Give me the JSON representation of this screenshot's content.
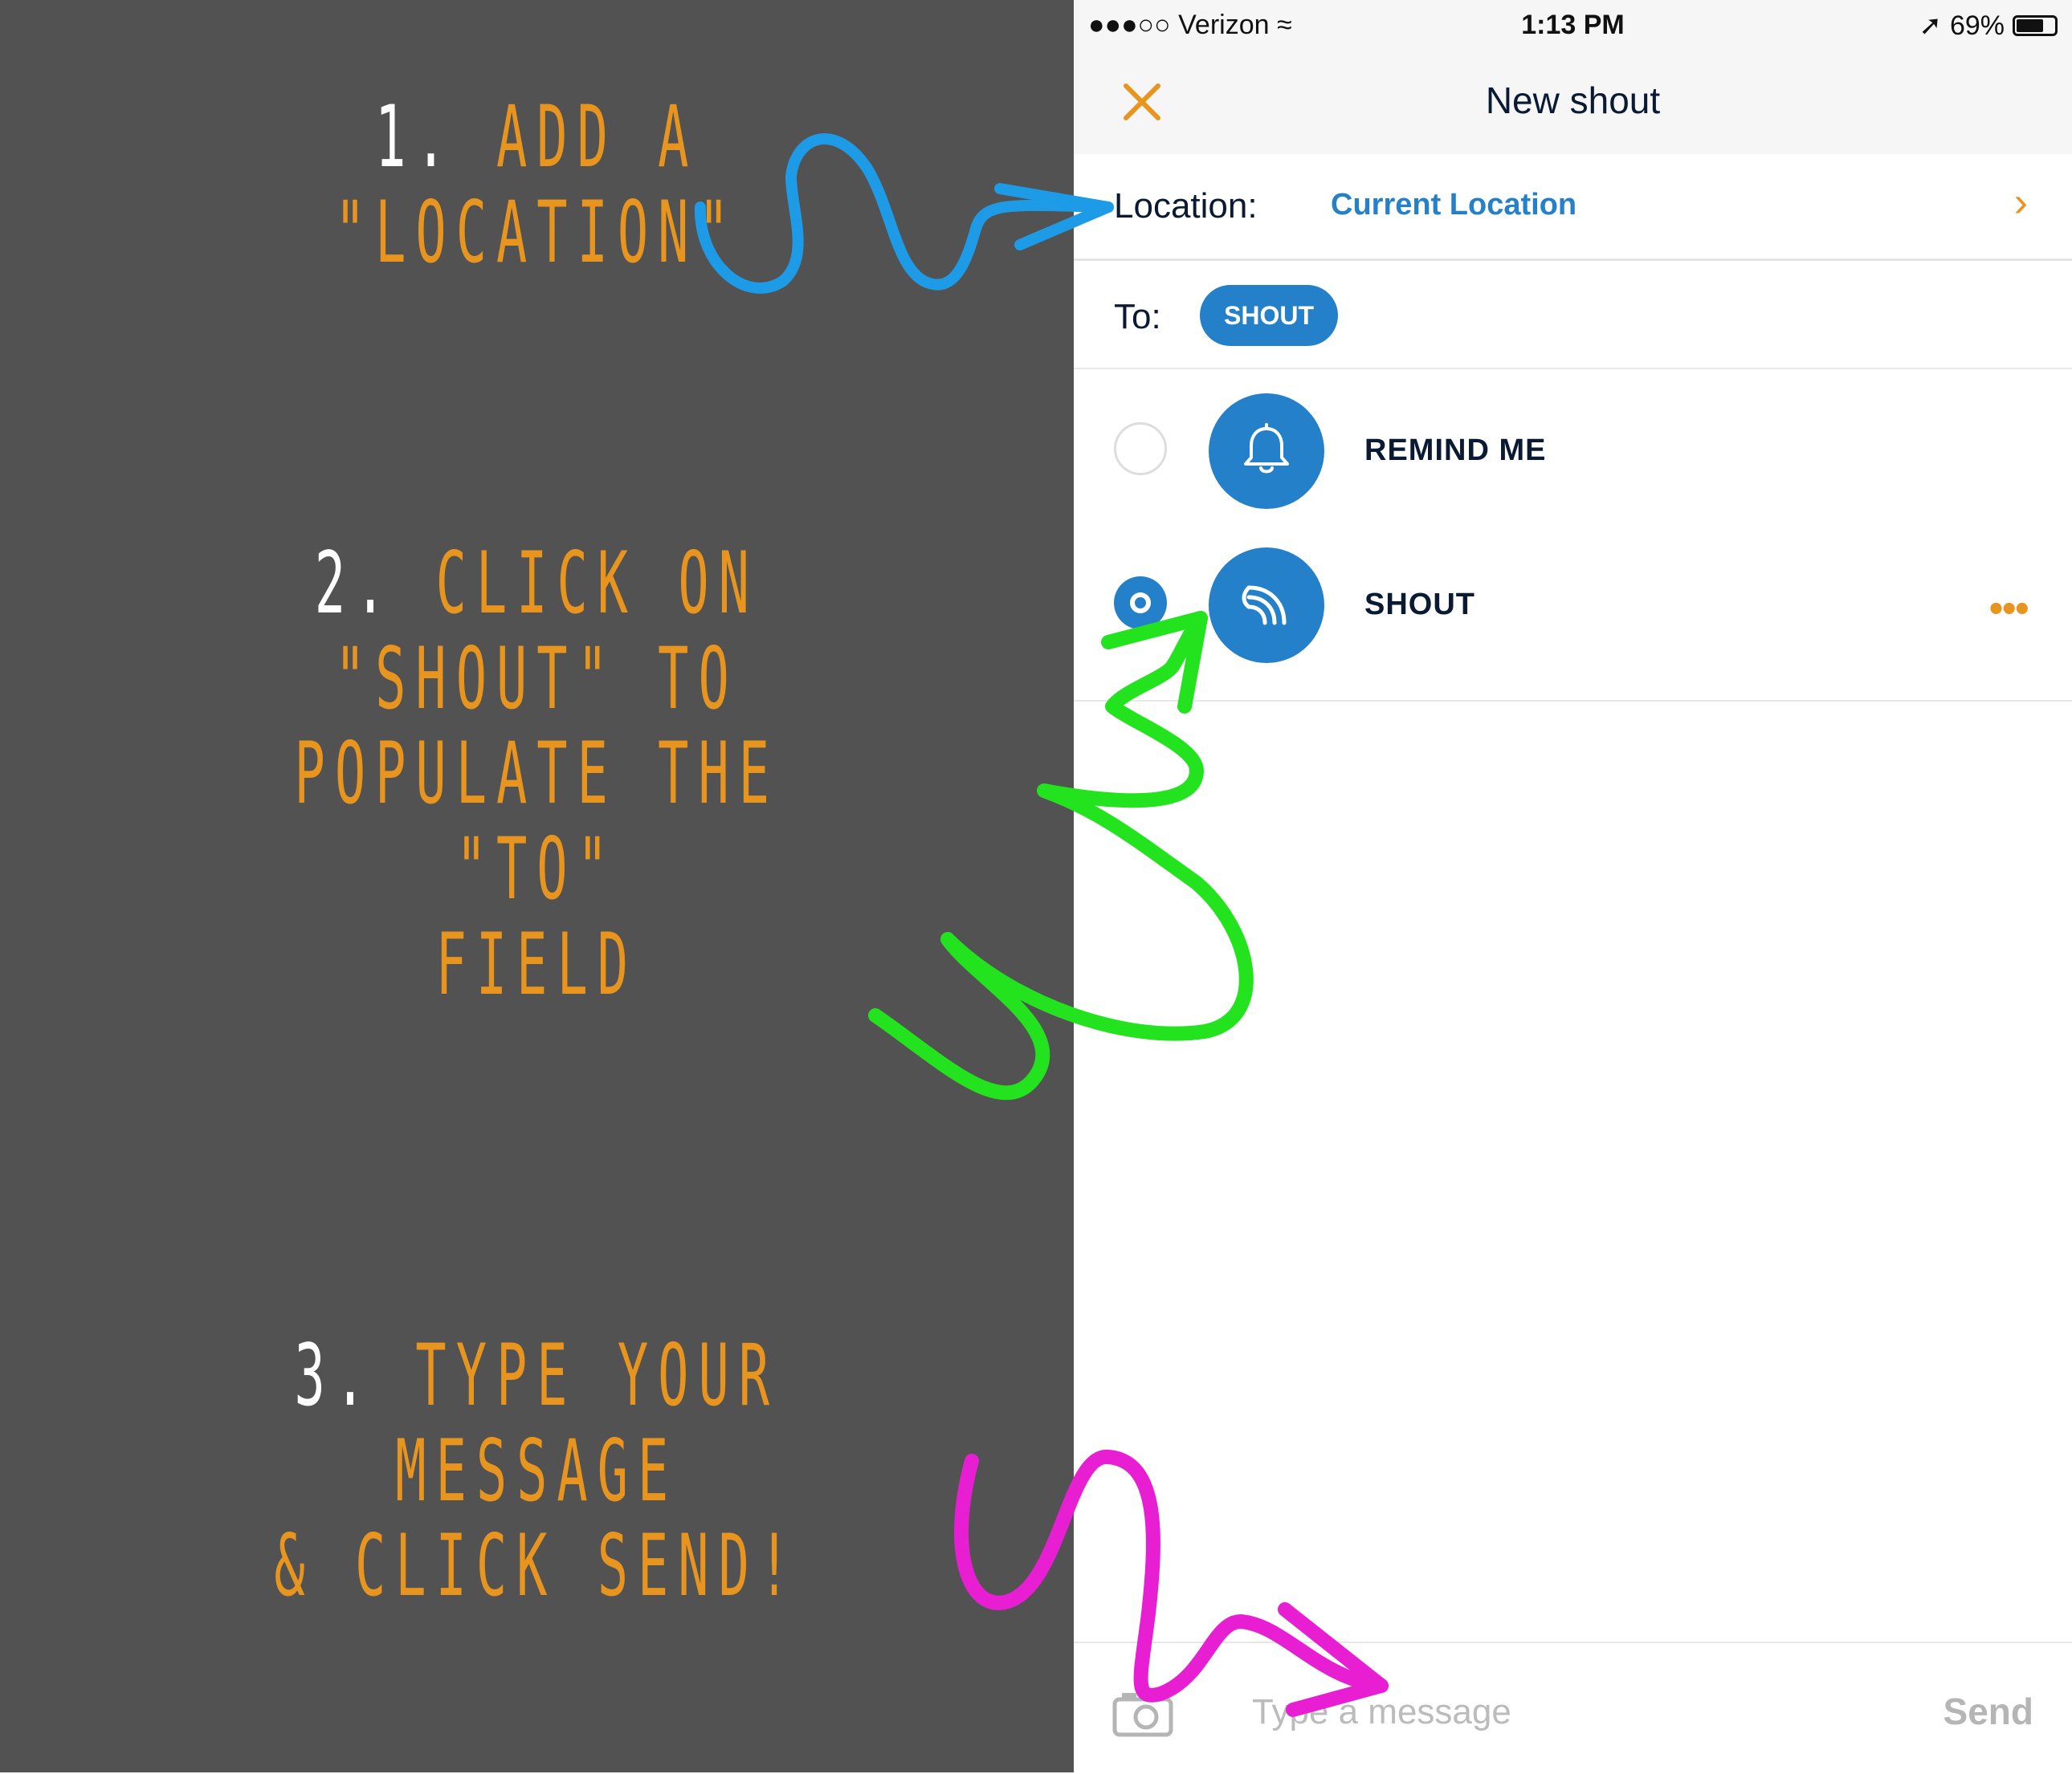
{
  "instructions": {
    "step1": {
      "number": "1.",
      "lines": [
        "ADD A",
        "\"LOCATION\""
      ]
    },
    "step2": {
      "number": "2.",
      "lines": [
        "CLICK ON",
        "\"SHOUT\" TO",
        "POPULATE THE \"TO\"",
        "FIELD"
      ]
    },
    "step3": {
      "number": "3.",
      "lines": [
        "TYPE YOUR MESSAGE",
        "& CLICK SEND!"
      ]
    }
  },
  "status_bar": {
    "carrier": "●●●○○ Verizon",
    "time": "1:13 PM",
    "battery": "69%"
  },
  "nav": {
    "close_icon": "close-icon",
    "title": "New shout"
  },
  "location": {
    "label": "Location:",
    "value": "Current Location",
    "chevron": "›"
  },
  "to": {
    "label": "To:",
    "chip": "SHOUT"
  },
  "options": [
    {
      "label": "REMIND ME",
      "icon": "bell-icon",
      "selected": false
    },
    {
      "label": "SHOUT",
      "icon": "broadcast-icon",
      "selected": true,
      "more": "•••"
    }
  ],
  "composer": {
    "placeholder": "Type a message",
    "value": "",
    "send_label": "Send"
  },
  "colors": {
    "accent_orange": "#E8951F",
    "brand_blue": "#2480C8",
    "panel_gray": "#525252",
    "arrow_blue": "#1E9BE6",
    "arrow_green": "#22E31E",
    "arrow_magenta": "#E81ED2"
  }
}
